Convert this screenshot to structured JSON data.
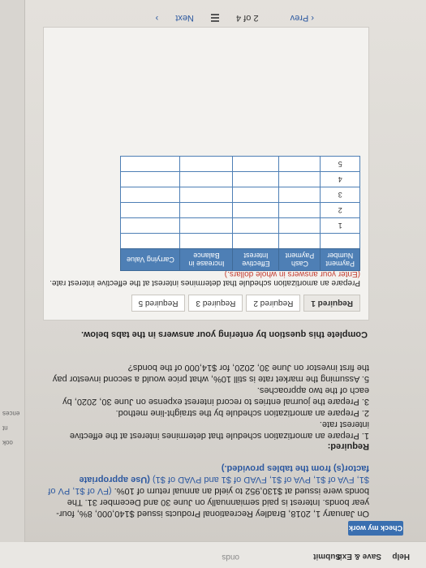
{
  "toolbar": {
    "title": "onds",
    "help": "Help",
    "save_exit": "Save & Exit",
    "submit": "Submit",
    "check_my_work": "Check my work"
  },
  "sidebar": {
    "items": [
      "ook",
      "nt",
      "ences"
    ]
  },
  "problem": {
    "text_1": "On January 1, 2018, Bradley Recreational Products issued $140,000, 8%, four-year bonds. Interest is paid semiannually on June 30 and December 31. The bonds were issued at $130,952 to yield an annual return of 10%. ",
    "links": "(FV of $1, PV of $1, FVA of $1, PVA of $1, FVAD of $1 and PVAD of $1)",
    "bold_note": " (Use appropriate factor(s) from the tables provided.)"
  },
  "requirements": {
    "title": "Required:",
    "items": [
      "1. Prepare an amortization schedule that determines interest at the effective interest rate.",
      "2. Prepare an amortization schedule by the straight-line method.",
      "3. Prepare the journal entries to record interest expense on June 30, 2020, by each of the two approaches.",
      "5. Assuming the market rate is still 10%, what price would a second investor pay the first investor on June 30, 2020, for $14,000 of the bonds?"
    ]
  },
  "instructions": "Complete this question by entering your answers in the tabs below.",
  "tabs": [
    {
      "label": "Required 1"
    },
    {
      "label": "Required 2"
    },
    {
      "label": "Required 3"
    },
    {
      "label": "Required 5"
    }
  ],
  "prepare": {
    "text": "Prepare an amortization schedule that determines interest at the effective interest rate. ",
    "note": "(Enter your answers in whole dollars.)"
  },
  "table": {
    "headers": [
      "Payment Number",
      "Cash Payment",
      "Effective Interest",
      "Increase in Balance",
      "Carrying Value"
    ],
    "rows": [
      "",
      "1",
      "2",
      "3",
      "4",
      "5"
    ]
  },
  "pager": {
    "prev": "Prev",
    "page": "2 of 4",
    "next": "Next"
  }
}
